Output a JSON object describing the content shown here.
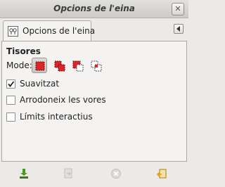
{
  "window": {
    "title": "Opcions de l'eina",
    "close_glyph": "✕"
  },
  "tab": {
    "label": "Opcions de l'eina",
    "icon": "tool-options-icon"
  },
  "section": {
    "title": "Tisores"
  },
  "mode": {
    "label": "Mode:",
    "options": [
      {
        "name": "replace-selection",
        "selected": true
      },
      {
        "name": "add-to-selection",
        "selected": false
      },
      {
        "name": "subtract-from-selection",
        "selected": false
      },
      {
        "name": "intersect-with-selection",
        "selected": false
      }
    ]
  },
  "options": [
    {
      "label": "Suavitzat",
      "checked": true
    },
    {
      "label": "Arrodoneix les vores",
      "checked": false
    },
    {
      "label": "Límits interactius",
      "checked": false
    }
  ],
  "bottom_buttons": [
    {
      "name": "save-options-icon",
      "enabled": true
    },
    {
      "name": "restore-options-icon",
      "enabled": false
    },
    {
      "name": "delete-options-icon",
      "enabled": false
    },
    {
      "name": "reset-options-icon",
      "enabled": true
    }
  ],
  "colors": {
    "accent_red": "#d9262b",
    "save_green": "#4a9a1e",
    "reset_orange": "#e8a11b"
  }
}
